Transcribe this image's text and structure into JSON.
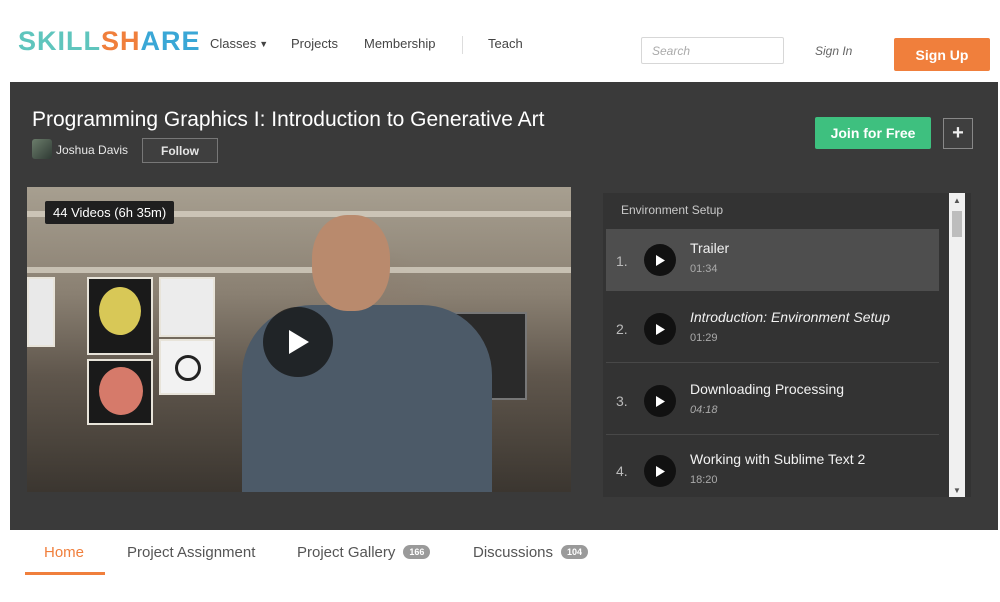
{
  "header": {
    "logo": {
      "part1": "SKILL",
      "part2": "SH",
      "part3": "ARE"
    },
    "nav": [
      "Classes",
      "Projects",
      "Membership",
      "Teach"
    ],
    "search_placeholder": "Search",
    "signin_label": "Sign In",
    "signup_label": "Sign Up"
  },
  "course": {
    "title": "Programming Graphics I: Introduction to Generative Art",
    "author": "Joshua Davis",
    "follow_label": "Follow",
    "join_label": "Join for Free",
    "plus_label": "+"
  },
  "video": {
    "badge": "44 Videos (6h 35m)"
  },
  "playlist": {
    "section": "Environment Setup",
    "items": [
      {
        "num": "1.",
        "title": "Trailer",
        "time": "01:34"
      },
      {
        "num": "2.",
        "title": "Introduction: Environment Setup",
        "time": "01:29"
      },
      {
        "num": "3.",
        "title": "Downloading Processing",
        "time": "04:18"
      },
      {
        "num": "4.",
        "title": "Working with Sublime Text 2",
        "time": "18:20"
      }
    ]
  },
  "tabs": [
    {
      "label": "Home",
      "count": ""
    },
    {
      "label": "Project Assignment",
      "count": ""
    },
    {
      "label": "Project Gallery",
      "count": "166"
    },
    {
      "label": "Discussions",
      "count": "104"
    }
  ],
  "colors": {
    "brand_orange": "#f07f3c",
    "join_green": "#3ec07f",
    "hero_dark": "#3a3a3a"
  }
}
